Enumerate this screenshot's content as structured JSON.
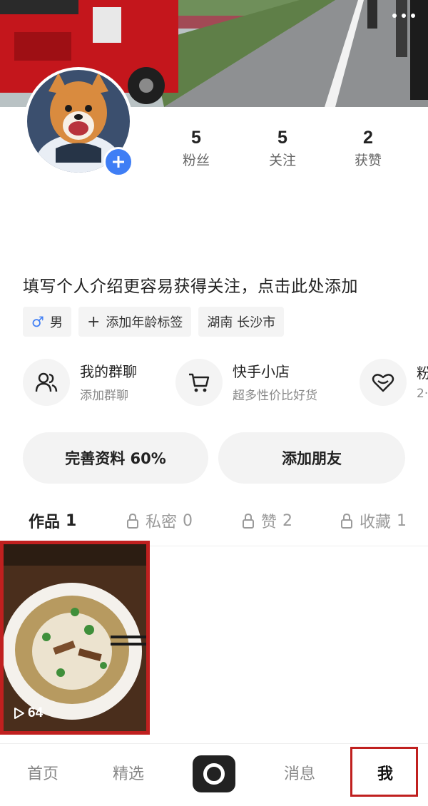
{
  "header": {
    "more_icon": "more-dots-icon"
  },
  "profile": {
    "stats": [
      {
        "value": "5",
        "label": "粉丝"
      },
      {
        "value": "5",
        "label": "关注"
      },
      {
        "value": "2",
        "label": "获赞"
      }
    ],
    "bio_placeholder": "填写个人介绍更容易获得关注，点击此处添加",
    "tags": {
      "gender": "男",
      "gender_icon": "male-icon",
      "add_age": "添加年龄标签",
      "location": "湖南 长沙市"
    }
  },
  "features": [
    {
      "title": "我的群聊",
      "subtitle": "添加群聊",
      "icon": "group-chat-icon"
    },
    {
      "title": "快手小店",
      "subtitle": "超多性价比好货",
      "icon": "shopping-cart-icon"
    },
    {
      "title": "粉",
      "subtitle": "2·",
      "icon": "fans-heart-icon"
    }
  ],
  "actions": {
    "complete_profile": "完善资料 60%",
    "add_friends": "添加朋友"
  },
  "tabs": [
    {
      "label": "作品",
      "count": "1",
      "locked": false
    },
    {
      "label": "私密",
      "count": "0",
      "locked": true
    },
    {
      "label": "赞",
      "count": "2",
      "locked": true
    },
    {
      "label": "收藏",
      "count": "1",
      "locked": true
    }
  ],
  "works": [
    {
      "plays": "64",
      "icon": "play-icon"
    }
  ],
  "bottom_nav": {
    "home": "首页",
    "featured": "精选",
    "camera_icon": "camera-icon",
    "messages": "消息",
    "me": "我"
  },
  "colors": {
    "accent_blue": "#3f7ef5",
    "highlight_red": "#c0201f"
  }
}
